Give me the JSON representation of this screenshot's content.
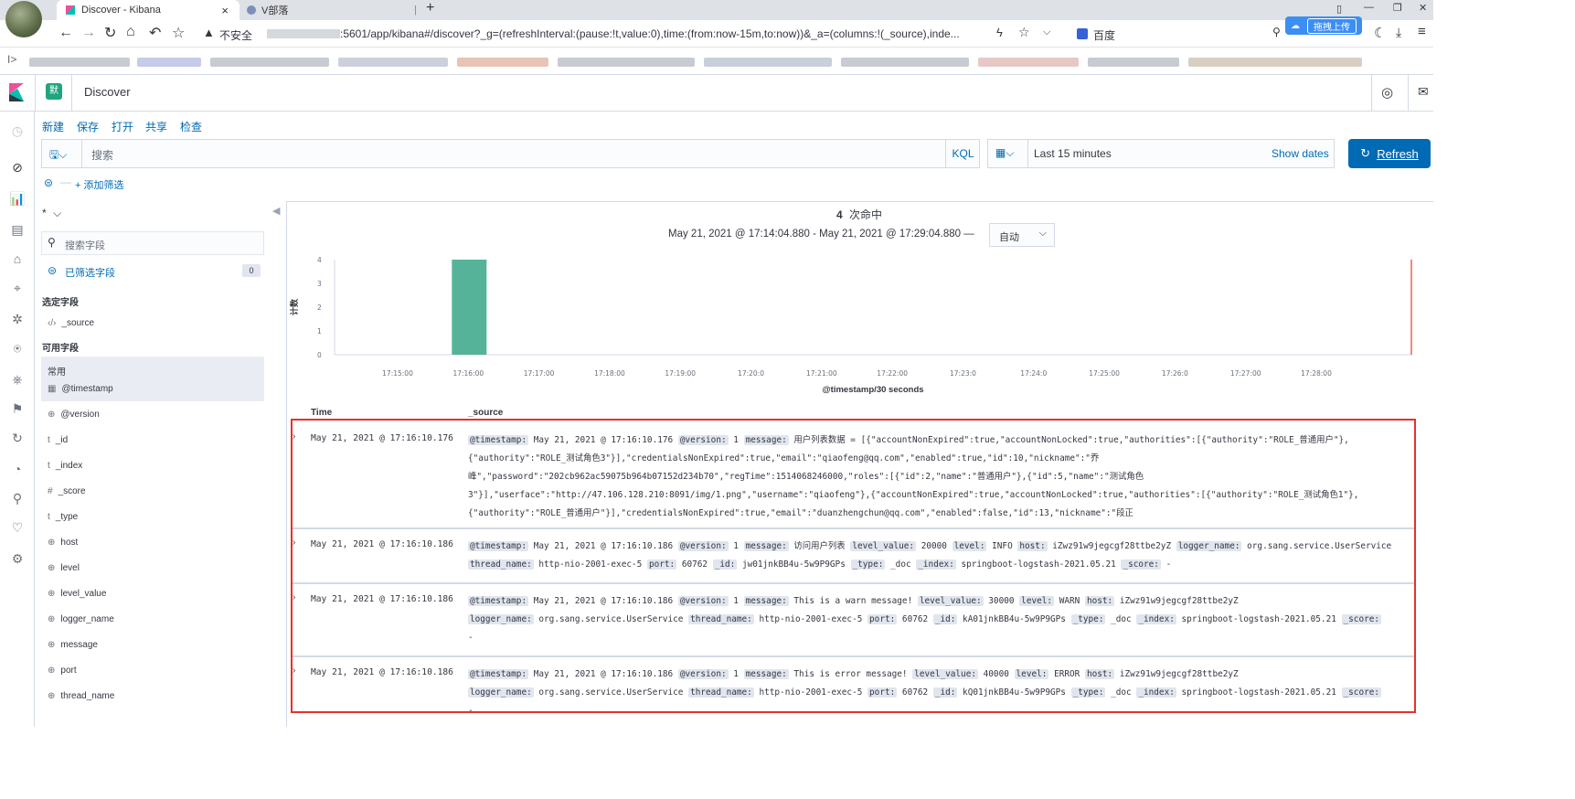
{
  "browser": {
    "tabs": [
      {
        "title": "Discover - Kibana",
        "close": "×",
        "active": true
      },
      {
        "title": "V部落",
        "close": "|",
        "active": false
      }
    ],
    "new_tab": "+",
    "security_label": "不安全",
    "url_suffix": ":5601/app/kibana#/discover?_g=(refreshInterval:(pause:!t,value:0),time:(from:now-15m,to:now))&_a=(columns:!(_source),inde...",
    "search_engine": "百度",
    "upload_pill": "拖拽上传",
    "window_controls": [
      "▯",
      "—",
      "❐",
      "✕"
    ]
  },
  "kibana": {
    "space_badge": "默",
    "app_title": "Discover",
    "top_menu": [
      "新建",
      "保存",
      "打开",
      "共享",
      "检查"
    ],
    "query_placeholder": "搜索",
    "kql_label": "KQL",
    "date_range": "Last 15 minutes",
    "show_dates": "Show dates",
    "refresh_label": "Refresh",
    "add_filter": "+ 添加筛选"
  },
  "sidebar": {
    "index_pattern": "*",
    "search_fields_placeholder": "搜索字段",
    "filtered_fields_label": "已筛选字段",
    "filtered_count": "0",
    "selected_fields_title": "选定字段",
    "selected_fields": [
      {
        "type": "‹/›",
        "name": "_source"
      }
    ],
    "available_fields_title": "可用字段",
    "common_label": "常用",
    "common_fields": [
      {
        "type": "▦",
        "name": "@timestamp"
      }
    ],
    "fields": [
      {
        "type": "⊕",
        "name": "@version"
      },
      {
        "type": "t",
        "name": "_id"
      },
      {
        "type": "t",
        "name": "_index"
      },
      {
        "type": "#",
        "name": "_score"
      },
      {
        "type": "t",
        "name": "_type"
      },
      {
        "type": "⊕",
        "name": "host"
      },
      {
        "type": "⊕",
        "name": "level"
      },
      {
        "type": "⊕",
        "name": "level_value"
      },
      {
        "type": "⊕",
        "name": "logger_name"
      },
      {
        "type": "⊕",
        "name": "message"
      },
      {
        "type": "⊕",
        "name": "port"
      },
      {
        "type": "⊕",
        "name": "thread_name"
      }
    ]
  },
  "results": {
    "hit_count": "4",
    "hit_label": "次命中",
    "time_range": "May 21, 2021 @ 17:14:04.880 - May 21, 2021 @ 17:29:04.880 —",
    "interval": "自动",
    "col_time": "Time",
    "col_source": "_source"
  },
  "chart_data": {
    "type": "bar",
    "xlabel": "@timestamp/30 seconds",
    "ylabel": "计数",
    "ylim": [
      0,
      4
    ],
    "yticks": [
      "0",
      "1",
      "2",
      "3",
      "4"
    ],
    "xticks": [
      "17:15:00",
      "17:16:00",
      "17:17:00",
      "17:18:00",
      "17:19:00",
      "17:20:0",
      "17:21:00",
      "17:22:00",
      "17:23:0",
      "17:24:0",
      "17:25:00",
      "17:26:0",
      "17:27:00",
      "17:28:00"
    ],
    "bars": [
      {
        "x": "17:16:00",
        "value": 4
      }
    ],
    "bar_color": "#54b399",
    "now_marker_color": "#e7664c"
  },
  "rows": [
    {
      "time": "May 21, 2021 @ 17:16:10.176",
      "lines": [
        [
          {
            "k": "@timestamp:",
            "v": "May 21, 2021 @ 17:16:10.176"
          },
          {
            "k": "@version:",
            "v": "1"
          },
          {
            "k": "message:",
            "v": "用户列表数据 = [{\"accountNonExpired\":true,\"accountNonLocked\":true,\"authorities\":[{\"authority\":\"ROLE_普通用户\"},"
          }
        ],
        [
          {
            "k": "",
            "v": "{\"authority\":\"ROLE_测试角色3\"}],\"credentialsNonExpired\":true,\"email\":\"qiaofeng@qq.com\",\"enabled\":true,\"id\":10,\"nickname\":\"乔"
          }
        ],
        [
          {
            "k": "",
            "v": "峰\",\"password\":\"202cb962ac59075b964b07152d234b70\",\"regTime\":1514068246000,\"roles\":[{\"id\":2,\"name\":\"普通用户\"},{\"id\":5,\"name\":\"测试角色"
          }
        ],
        [
          {
            "k": "",
            "v": "3\"}],\"userface\":\"http://47.106.128.210:8091/img/1.png\",\"username\":\"qiaofeng\"},{\"accountNonExpired\":true,\"accountNonLocked\":true,\"authorities\":[{\"authority\":\"ROLE_测试角色1\"},"
          }
        ],
        [
          {
            "k": "",
            "v": "{\"authority\":\"ROLE_普通用户\"}],\"credentialsNonExpired\":true,\"email\":\"duanzhengchun@qq.com\",\"enabled\":false,\"id\":13,\"nickname\":\"段正"
          }
        ]
      ]
    },
    {
      "time": "May 21, 2021 @ 17:16:10.186",
      "lines": [
        [
          {
            "k": "@timestamp:",
            "v": "May 21, 2021 @ 17:16:10.186"
          },
          {
            "k": "@version:",
            "v": "1"
          },
          {
            "k": "message:",
            "v": "访问用户列表"
          },
          {
            "k": "level_value:",
            "v": "20000"
          },
          {
            "k": "level:",
            "v": "INFO"
          },
          {
            "k": "host:",
            "v": "iZwz91w9jegcgf28ttbe2yZ"
          },
          {
            "k": "logger_name:",
            "v": "org.sang.service.UserService"
          }
        ],
        [
          {
            "k": "thread_name:",
            "v": "http-nio-2001-exec-5"
          },
          {
            "k": "port:",
            "v": "60762"
          },
          {
            "k": "_id:",
            "v": "jw01jnkBB4u-5w9P9GPs"
          },
          {
            "k": "_type:",
            "v": "_doc"
          },
          {
            "k": "_index:",
            "v": "springboot-logstash-2021.05.21"
          },
          {
            "k": "_score:",
            "v": " -"
          }
        ]
      ]
    },
    {
      "time": "May 21, 2021 @ 17:16:10.186",
      "lines": [
        [
          {
            "k": "@timestamp:",
            "v": "May 21, 2021 @ 17:16:10.186"
          },
          {
            "k": "@version:",
            "v": "1"
          },
          {
            "k": "message:",
            "v": "This is a warn message!"
          },
          {
            "k": "level_value:",
            "v": "30000"
          },
          {
            "k": "level:",
            "v": "WARN"
          },
          {
            "k": "host:",
            "v": "iZwz91w9jegcgf28ttbe2yZ"
          }
        ],
        [
          {
            "k": "logger_name:",
            "v": "org.sang.service.UserService"
          },
          {
            "k": "thread_name:",
            "v": "http-nio-2001-exec-5"
          },
          {
            "k": "port:",
            "v": "60762"
          },
          {
            "k": "_id:",
            "v": "kA01jnkBB4u-5w9P9GPs"
          },
          {
            "k": "_type:",
            "v": "_doc"
          },
          {
            "k": "_index:",
            "v": "springboot-logstash-2021.05.21"
          },
          {
            "k": "_score:",
            "v": ""
          }
        ],
        [
          {
            "k": "",
            "v": "-"
          }
        ]
      ]
    },
    {
      "time": "May 21, 2021 @ 17:16:10.186",
      "lines": [
        [
          {
            "k": "@timestamp:",
            "v": "May 21, 2021 @ 17:16:10.186"
          },
          {
            "k": "@version:",
            "v": "1"
          },
          {
            "k": "message:",
            "v": "This is error message!"
          },
          {
            "k": "level_value:",
            "v": "40000"
          },
          {
            "k": "level:",
            "v": "ERROR"
          },
          {
            "k": "host:",
            "v": "iZwz91w9jegcgf28ttbe2yZ"
          }
        ],
        [
          {
            "k": "logger_name:",
            "v": "org.sang.service.UserService"
          },
          {
            "k": "thread_name:",
            "v": "http-nio-2001-exec-5"
          },
          {
            "k": "port:",
            "v": "60762"
          },
          {
            "k": "_id:",
            "v": "kQ01jnkBB4u-5w9P9GPs"
          },
          {
            "k": "_type:",
            "v": "_doc"
          },
          {
            "k": "_index:",
            "v": "springboot-logstash-2021.05.21"
          },
          {
            "k": "_score:",
            "v": ""
          }
        ],
        [
          {
            "k": "",
            "v": "-"
          }
        ]
      ]
    }
  ],
  "highlight_color": "#e7302a"
}
